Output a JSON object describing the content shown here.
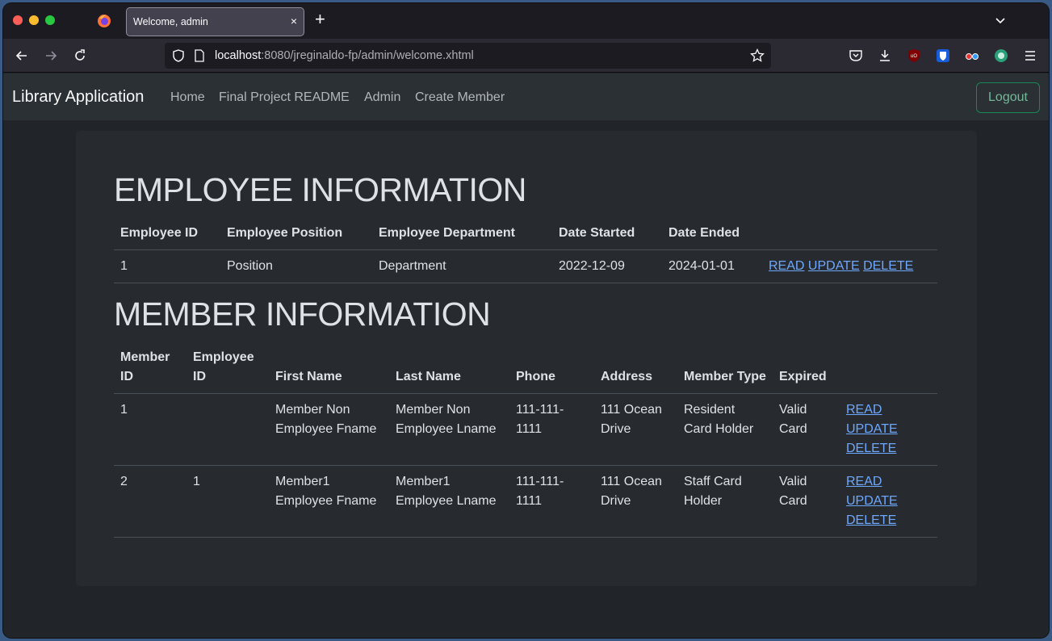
{
  "browser": {
    "tab_title": "Welcome, admin",
    "tab_close": "×",
    "new_tab": "+",
    "url_host": "localhost",
    "url_path": ":8080/jreginaldo-fp/admin/welcome.xhtml"
  },
  "app": {
    "brand": "Library Application",
    "nav": [
      "Home",
      "Final Project README",
      "Admin",
      "Create Member"
    ],
    "logout": "Logout"
  },
  "employee_section": {
    "title": "EMPLOYEE INFORMATION",
    "headers": [
      "Employee ID",
      "Employee Position",
      "Employee Department",
      "Date Started",
      "Date Ended"
    ],
    "rows": [
      {
        "id": "1",
        "position": "Position",
        "department": "Department",
        "started": "2022-12-09",
        "ended": "2024-01-01",
        "actions": [
          "READ",
          "UPDATE",
          "DELETE"
        ]
      }
    ]
  },
  "member_section": {
    "title": "MEMBER INFORMATION",
    "headers": [
      "Member ID",
      "Employee ID",
      "First Name",
      "Last Name",
      "Phone",
      "Address",
      "Member Type",
      "Expired"
    ],
    "rows": [
      {
        "member_id": "1",
        "employee_id": "",
        "first": "Member Non Employee Fname",
        "last": "Member Non Employee Lname",
        "phone": "111-111-1111",
        "address": "111 Ocean Drive",
        "type": "Resident Card Holder",
        "expired": "Valid Card",
        "actions": [
          "READ",
          "UPDATE",
          "DELETE"
        ]
      },
      {
        "member_id": "2",
        "employee_id": "1",
        "first": "Member1 Employee Fname",
        "last": "Member1 Employee Lname",
        "phone": "111-111-1111",
        "address": "111 Ocean Drive",
        "type": "Staff Card Holder",
        "expired": "Valid Card",
        "actions": [
          "READ",
          "UPDATE",
          "DELETE"
        ]
      }
    ]
  },
  "icons": [
    "firefox-icon",
    "back-icon",
    "forward-icon",
    "reload-icon",
    "shield-icon",
    "page-icon",
    "bookmark-star-icon",
    "pocket-icon",
    "download-icon",
    "ublock-icon",
    "bitwarden-icon",
    "extension-glasses-icon",
    "sync-icon",
    "menu-icon",
    "tab-list-chevron-icon"
  ],
  "colors": {
    "accent_link": "#6ea8fe",
    "logout_green": "#198754"
  }
}
